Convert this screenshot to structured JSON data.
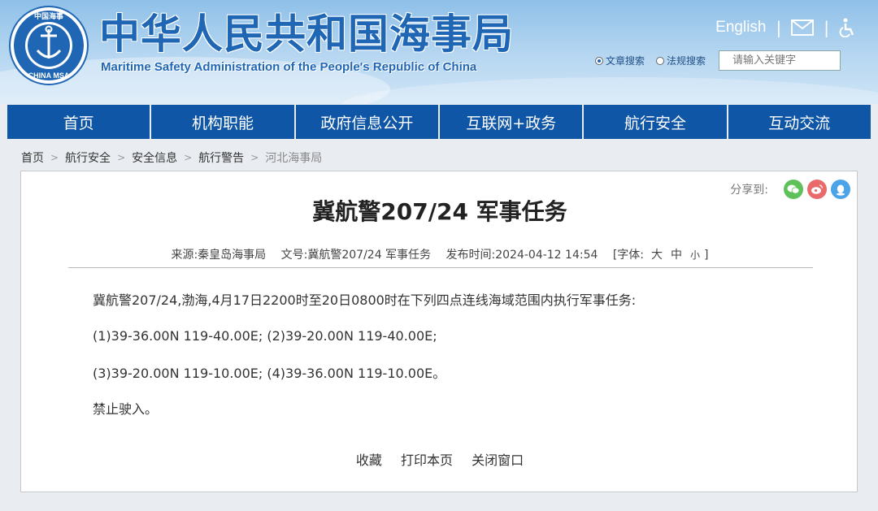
{
  "header": {
    "title_cn": "中华人民共和国海事局",
    "title_en": "Maritime Safety Administration of the People's Republic of China",
    "logo_text_top": "中国海事",
    "logo_text_bottom": "CHINA MSA",
    "lang_link": "English",
    "colors": {
      "brand_blue": "#1f66b4",
      "nav_blue": "#0f56a6"
    }
  },
  "search": {
    "options": [
      "文章搜索",
      "法规搜索"
    ],
    "selected": "文章搜索",
    "placeholder": "请输入关键字"
  },
  "nav": {
    "items": [
      "首页",
      "机构职能",
      "政府信息公开",
      "互联网+政务",
      "航行安全",
      "互动交流"
    ]
  },
  "breadcrumb": {
    "items": [
      "首页",
      "航行安全",
      "安全信息",
      "航行警告",
      "河北海事局"
    ]
  },
  "share": {
    "label": "分享到:"
  },
  "article": {
    "title": "冀航警207/24 军事任务",
    "meta": {
      "source": "来源:秦皇岛海事局",
      "doc_no": "文号:冀航警207/24 军事任务",
      "publish_time": "发布时间:2024-04-12 14:54",
      "font_label": "[字体:",
      "font_large": "大",
      "font_medium": "中",
      "font_small": "小",
      "font_close": "]"
    },
    "paragraphs": [
      "冀航警207/24,渤海,4月17日2200时至20日0800时在下列四点连线海域范围内执行军事任务:",
      "(1)39-36.00N 119-40.00E; (2)39-20.00N 119-40.00E;",
      "(3)39-20.00N 119-10.00E; (4)39-36.00N 119-10.00E。",
      "禁止驶入。"
    ],
    "actions": [
      "收藏",
      "打印本页",
      "关闭窗口"
    ]
  }
}
